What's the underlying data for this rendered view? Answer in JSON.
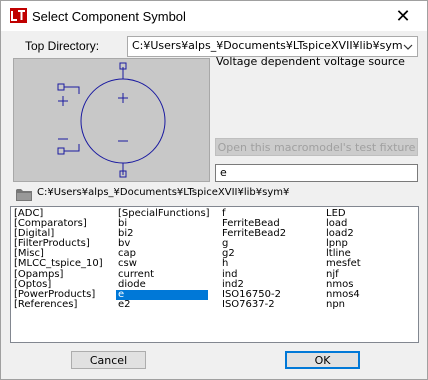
{
  "window": {
    "title": "Select Component Symbol",
    "close_label": "✕"
  },
  "top_directory": {
    "label": "Top Directory:",
    "value": "C:¥Users¥alps_¥Documents¥LTspiceXVII¥lib¥sym"
  },
  "description": "Voltage dependent voltage source",
  "test_fixture_button": "Open this macromodel's test fixture",
  "filter_input": "e",
  "current_path": "C:¥Users¥alps_¥Documents¥LTspiceXVII¥lib¥sym¥",
  "list": {
    "columns": [
      [
        "[ADC]",
        "[Comparators]",
        "[Digital]",
        "[FilterProducts]",
        "[Misc]",
        "[MLCC_tspice_10]",
        "[Opamps]",
        "[Optos]",
        "[PowerProducts]",
        "[References]"
      ],
      [
        "[SpecialFunctions]",
        "bi",
        "bi2",
        "bv",
        "cap",
        "csw",
        "current",
        "diode",
        "e",
        "e2"
      ],
      [
        "f",
        "FerriteBead",
        "FerriteBead2",
        "g",
        "g2",
        "h",
        "ind",
        "ind2",
        "ISO16750-2",
        "ISO7637-2"
      ],
      [
        "LED",
        "load",
        "load2",
        "lpnp",
        "ltline",
        "mesfet",
        "njf",
        "nmos",
        "nmos4",
        "npn"
      ]
    ],
    "selected": "e"
  },
  "buttons": {
    "cancel": "Cancel",
    "ok": "OK"
  },
  "symbol": {
    "plus": "+",
    "minus": "−"
  },
  "colors": {
    "symbol_stroke": "#1a1aa0",
    "preview_bg": "#c8c8c8",
    "selection": "#0078d7"
  }
}
